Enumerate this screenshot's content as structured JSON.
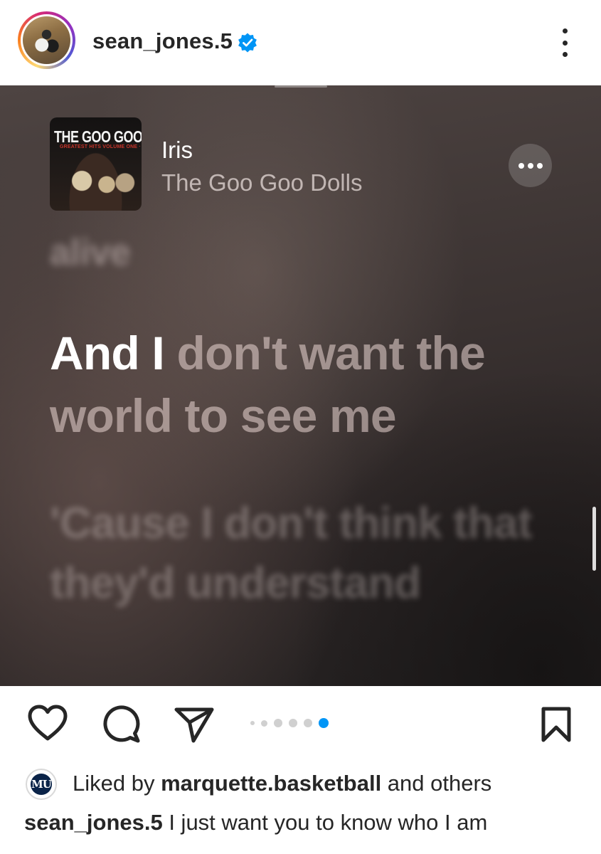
{
  "post": {
    "username": "sean_jones.5",
    "verified": true,
    "header_icons": {
      "avatar": "profile-photo",
      "verified": "verified-badge-icon",
      "more": "more-vertical-icon"
    }
  },
  "media": {
    "song": {
      "title": "Iris",
      "artist": "The Goo Goo Dolls",
      "album_art_text": "THE GOO GOO DOLLS",
      "album_art_subtext": "GREATEST HITS VOLUME ONE · THE SINGLES"
    },
    "lyrics": {
      "previous": "alive",
      "current_sung": "And I",
      "current_unsung": " don't want the world to see me",
      "next": "'Cause I don't think that they'd understand"
    },
    "more_icon": "more-horizontal-icon"
  },
  "actions": {
    "icons": [
      "heart-icon",
      "comment-icon",
      "share-icon",
      "bookmark-icon"
    ],
    "carousel_total_dots": 6,
    "carousel_active_index": 5,
    "active_dot_color": "#0095f6"
  },
  "likes": {
    "prefix": "Liked by ",
    "user": "marquette.basketball",
    "suffix": " and others",
    "user_avatar_text": "MU"
  },
  "caption": {
    "username": "sean_jones.5",
    "text": " I just want you to know who I am"
  }
}
